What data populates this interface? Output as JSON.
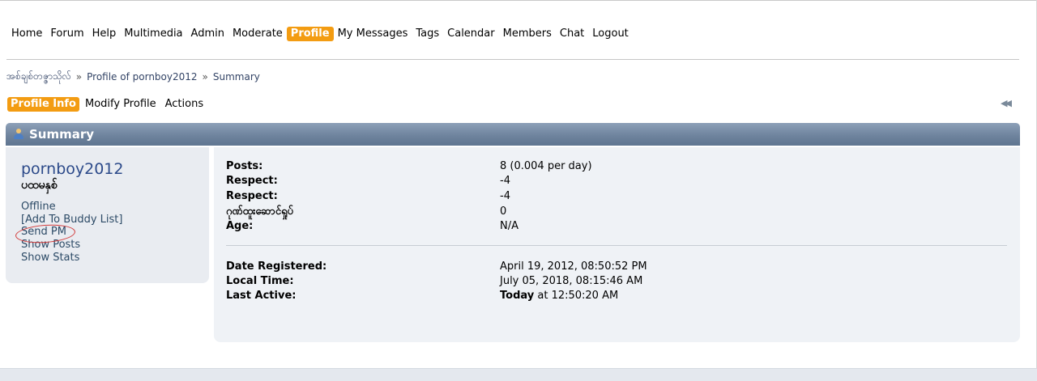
{
  "menu": {
    "items": [
      {
        "label": "Home",
        "active": false
      },
      {
        "label": "Forum",
        "active": false
      },
      {
        "label": "Help",
        "active": false
      },
      {
        "label": "Multimedia",
        "active": false
      },
      {
        "label": "Admin",
        "active": false
      },
      {
        "label": "Moderate",
        "active": false
      },
      {
        "label": "Profile",
        "active": true
      },
      {
        "label": "My Messages",
        "active": false
      },
      {
        "label": "Tags",
        "active": false
      },
      {
        "label": "Calendar",
        "active": false
      },
      {
        "label": "Members",
        "active": false
      },
      {
        "label": "Chat",
        "active": false
      },
      {
        "label": "Logout",
        "active": false
      }
    ]
  },
  "breadcrumb": {
    "items": [
      "အစ်ချစ်တဇ္ဇာသိုလ်",
      "Profile of pornboy2012",
      "Summary"
    ],
    "separator": "»"
  },
  "subtabs": {
    "items": [
      {
        "label": "Profile Info",
        "active": true
      },
      {
        "label": "Modify Profile",
        "active": false
      },
      {
        "label": "Actions",
        "active": false
      }
    ],
    "collapse_icon": "double-chevron-left-icon"
  },
  "summary": {
    "title": "Summary",
    "icon": "user-icon",
    "header_color": "#6f849e"
  },
  "user": {
    "name": "pornboy2012",
    "title": "ပထမနှစ်",
    "status": "Offline",
    "links": {
      "add_buddy": "[Add To Buddy List]",
      "send_pm": "Send PM",
      "show_posts": "Show Posts",
      "show_stats": "Show Stats"
    }
  },
  "stats": {
    "group1": [
      {
        "label": "Posts:",
        "value": "8 (0.004 per day)"
      },
      {
        "label": "Respect:",
        "value": "-4"
      },
      {
        "label": "Respect:",
        "value": "-4"
      },
      {
        "label": "ဂုဏ်ထူးဆောင်ရှုပ်",
        "value": "0"
      },
      {
        "label": "Age:",
        "value": "N/A"
      }
    ],
    "group2": [
      {
        "label": "Date Registered:",
        "value": "April 19, 2012, 08:50:52 PM"
      },
      {
        "label": "Local Time:",
        "value": "July 05, 2018, 08:15:46 AM"
      },
      {
        "label": "Last Active:",
        "value_bold": "Today",
        "value_rest": " at 12:50:20 AM"
      }
    ]
  },
  "colors": {
    "accent": "#f39c12",
    "link": "#2c4a8a",
    "annotation": "#d23a3a"
  }
}
